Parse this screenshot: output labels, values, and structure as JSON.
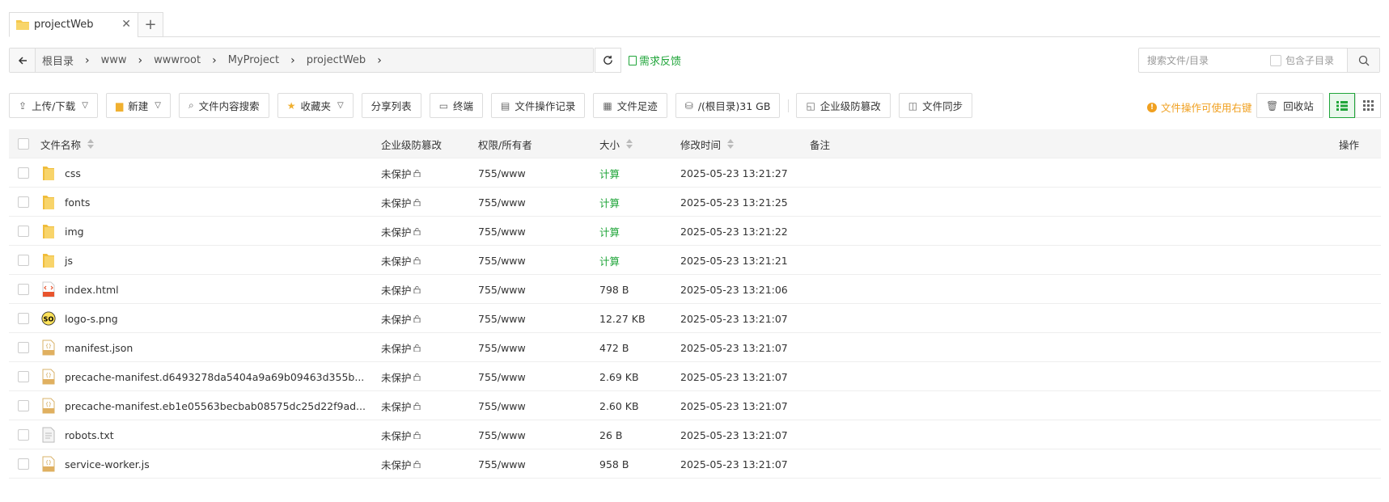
{
  "tabs": [
    {
      "label": "projectWeb",
      "close": "✕"
    }
  ],
  "tab_add": "+",
  "breadcrumb": [
    "根目录",
    "www",
    "wwwroot",
    "MyProject",
    "projectWeb"
  ],
  "feedback_label": "需求反馈",
  "search": {
    "placeholder": "搜索文件/目录",
    "include_sub_label": "包含子目录"
  },
  "toolbar": {
    "upload_download": "上传/下载",
    "new": "新建",
    "content_search": "文件内容搜索",
    "favorites": "收藏夹",
    "share_list": "分享列表",
    "terminal": "终端",
    "op_log": "文件操作记录",
    "footprint": "文件足迹",
    "disk": "/(根目录)31 GB",
    "tamper": "企业级防篡改",
    "sync": "文件同步",
    "hint": "文件操作可使用右键",
    "recycle": "回收站"
  },
  "columns": {
    "name": "文件名称",
    "protection": "企业级防篡改",
    "permission": "权限/所有者",
    "size": "大小",
    "mtime": "修改时间",
    "note": "备注",
    "ops": "操作"
  },
  "files": [
    {
      "name": "css",
      "type": "folder",
      "protection": "未保护",
      "permission": "755/www",
      "size": "计算",
      "mtime": "2025-05-23 13:21:27"
    },
    {
      "name": "fonts",
      "type": "folder",
      "protection": "未保护",
      "permission": "755/www",
      "size": "计算",
      "mtime": "2025-05-23 13:21:25"
    },
    {
      "name": "img",
      "type": "folder",
      "protection": "未保护",
      "permission": "755/www",
      "size": "计算",
      "mtime": "2025-05-23 13:21:22"
    },
    {
      "name": "js",
      "type": "folder",
      "protection": "未保护",
      "permission": "755/www",
      "size": "计算",
      "mtime": "2025-05-23 13:21:21"
    },
    {
      "name": "index.html",
      "type": "html",
      "protection": "未保护",
      "permission": "755/www",
      "size": "798 B",
      "mtime": "2025-05-23 13:21:06"
    },
    {
      "name": "logo-s.png",
      "type": "png",
      "protection": "未保护",
      "permission": "755/www",
      "size": "12.27 KB",
      "mtime": "2025-05-23 13:21:07"
    },
    {
      "name": "manifest.json",
      "type": "json",
      "protection": "未保护",
      "permission": "755/www",
      "size": "472 B",
      "mtime": "2025-05-23 13:21:07"
    },
    {
      "name": "precache-manifest.d6493278da5404a9a69b09463d355b...",
      "type": "js",
      "protection": "未保护",
      "permission": "755/www",
      "size": "2.69 KB",
      "mtime": "2025-05-23 13:21:07"
    },
    {
      "name": "precache-manifest.eb1e05563becbab08575dc25d22f9ad...",
      "type": "js",
      "protection": "未保护",
      "permission": "755/www",
      "size": "2.60 KB",
      "mtime": "2025-05-23 13:21:07"
    },
    {
      "name": "robots.txt",
      "type": "txt",
      "protection": "未保护",
      "permission": "755/www",
      "size": "26 B",
      "mtime": "2025-05-23 13:21:07"
    },
    {
      "name": "service-worker.js",
      "type": "js",
      "protection": "未保护",
      "permission": "755/www",
      "size": "958 B",
      "mtime": "2025-05-23 13:21:07"
    }
  ],
  "colors": {
    "accent": "#20a53a",
    "warning": "#f0a020",
    "folder": "#f5c84c"
  }
}
